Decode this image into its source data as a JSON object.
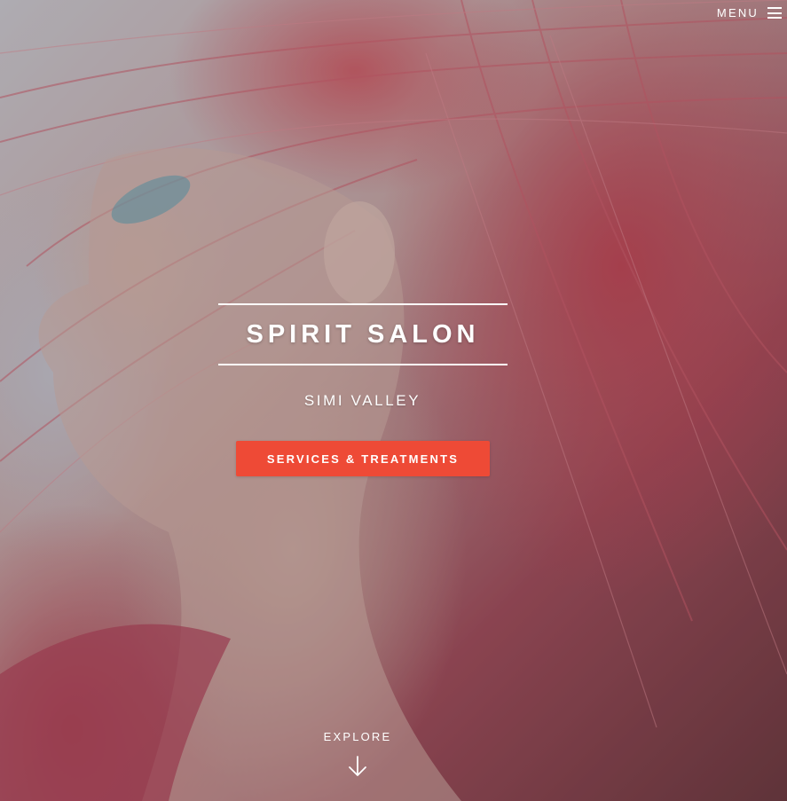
{
  "header": {
    "menu_label": "MENU",
    "menu_icon": "hamburger-icon"
  },
  "hero": {
    "title": "SPIRIT SALON",
    "subtitle": "SIMI VALLEY",
    "cta_label": "SERVICES & TREATMENTS",
    "explore_label": "EXPLORE",
    "explore_icon": "arrow-down-icon"
  },
  "colors": {
    "accent": "#ee4a36",
    "text": "#ffffff",
    "hair": "#c24a5a"
  }
}
